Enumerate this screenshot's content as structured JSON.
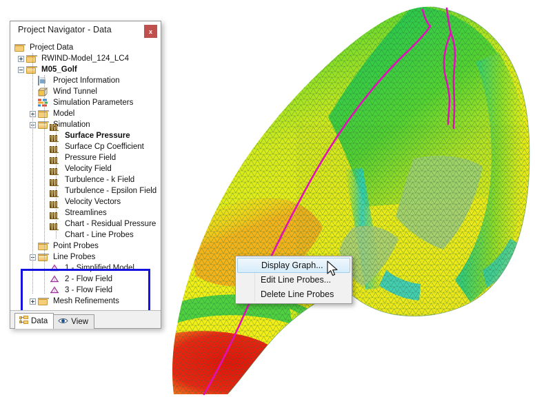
{
  "window": {
    "title": "Project Navigator - Data",
    "close_label": "x",
    "close_icon": "close-icon"
  },
  "tree": {
    "nodes": [
      {
        "id": "project-data",
        "label": "Project Data",
        "indent": 0,
        "icon": "folder-icon",
        "expander": "none",
        "bold": false
      },
      {
        "id": "rwind-model",
        "label": "RWIND-Model_124_LC4",
        "indent": 1,
        "icon": "folder-icon",
        "expander": "plus",
        "bold": false
      },
      {
        "id": "m05-golf",
        "label": "M05_Golf",
        "indent": 1,
        "icon": "folder-open-icon",
        "expander": "minus",
        "bold": true
      },
      {
        "id": "project-information",
        "label": "Project Information",
        "indent": 2,
        "icon": "document-icon",
        "expander": "none",
        "bold": false
      },
      {
        "id": "wind-tunnel",
        "label": "Wind Tunnel",
        "indent": 2,
        "icon": "cube-icon",
        "expander": "none",
        "bold": false
      },
      {
        "id": "simulation-parameters",
        "label": "Simulation Parameters",
        "indent": 2,
        "icon": "parameters-icon",
        "expander": "none",
        "bold": false
      },
      {
        "id": "model",
        "label": "Model",
        "indent": 2,
        "icon": "folder-icon",
        "expander": "plus",
        "bold": false
      },
      {
        "id": "simulation",
        "label": "Simulation",
        "indent": 2,
        "icon": "folder-open-icon",
        "expander": "minus",
        "bold": false
      },
      {
        "id": "surface-pressure",
        "label": "Surface Pressure",
        "indent": 3,
        "icon": "chart-icon",
        "expander": "none",
        "bold": true
      },
      {
        "id": "surface-cp-coefficient",
        "label": "Surface Cp Coefficient",
        "indent": 3,
        "icon": "chart-icon",
        "expander": "none",
        "bold": false
      },
      {
        "id": "pressure-field",
        "label": "Pressure Field",
        "indent": 3,
        "icon": "chart-icon",
        "expander": "none",
        "bold": false
      },
      {
        "id": "velocity-field",
        "label": "Velocity Field",
        "indent": 3,
        "icon": "chart-icon",
        "expander": "none",
        "bold": false
      },
      {
        "id": "turbulence-k-field",
        "label": "Turbulence - k Field",
        "indent": 3,
        "icon": "chart-icon",
        "expander": "none",
        "bold": false
      },
      {
        "id": "turbulence-epsilon",
        "label": "Turbulence - Epsilon Field",
        "indent": 3,
        "icon": "chart-icon",
        "expander": "none",
        "bold": false
      },
      {
        "id": "velocity-vectors",
        "label": "Velocity Vectors",
        "indent": 3,
        "icon": "chart-icon",
        "expander": "none",
        "bold": false
      },
      {
        "id": "streamlines",
        "label": "Streamlines",
        "indent": 3,
        "icon": "chart-icon",
        "expander": "none",
        "bold": false
      },
      {
        "id": "chart-residual-pressure",
        "label": "Chart - Residual Pressure",
        "indent": 3,
        "icon": "chart-icon",
        "expander": "none",
        "bold": false
      },
      {
        "id": "chart-line-probes",
        "label": "Chart - Line Probes",
        "indent": 3,
        "icon": "chart-icon",
        "expander": "none",
        "bold": false
      },
      {
        "id": "point-probes",
        "label": "Point Probes",
        "indent": 2,
        "icon": "folder-icon",
        "expander": "none",
        "bold": false
      },
      {
        "id": "line-probes",
        "label": "Line Probes",
        "indent": 2,
        "icon": "folder-open-icon",
        "expander": "minus",
        "bold": false
      },
      {
        "id": "line-probe-1",
        "label": "1 - Simplified Model",
        "indent": 3,
        "icon": "line-probe-icon",
        "expander": "none",
        "bold": false
      },
      {
        "id": "line-probe-2",
        "label": "2 - Flow Field",
        "indent": 3,
        "icon": "line-probe-icon",
        "expander": "none",
        "bold": false
      },
      {
        "id": "line-probe-3",
        "label": "3 - Flow Field",
        "indent": 3,
        "icon": "line-probe-icon",
        "expander": "none",
        "bold": false
      },
      {
        "id": "mesh-refinements",
        "label": "Mesh Refinements",
        "indent": 2,
        "icon": "folder-icon",
        "expander": "plus",
        "bold": false
      }
    ],
    "highlight_color": "#1414e0",
    "highlighted_group": "Line Probes"
  },
  "tabs": [
    {
      "id": "data",
      "label": "Data",
      "icon": "data-tree-icon",
      "active": true
    },
    {
      "id": "view",
      "label": "View",
      "icon": "eye-icon",
      "active": false
    }
  ],
  "context_menu": {
    "items": [
      {
        "id": "display-graph",
        "label": "Display Graph...",
        "highlighted": true
      },
      {
        "id": "edit-line-probes",
        "label": "Edit Line Probes...",
        "highlighted": false
      },
      {
        "id": "delete-line-probes",
        "label": "Delete Line Probes",
        "highlighted": false
      }
    ]
  },
  "viewport": {
    "name": "cfd-surface-pressure-view",
    "description": "3D car body meshed surface colored by pressure with magenta line probes",
    "colors": {
      "red": "#ee1b16",
      "orange": "#f58b1f",
      "yellow": "#f2ef18",
      "green": "#2fc52f",
      "cyan": "#1ecfd6",
      "blue": "#1832d8",
      "probe_line": "#e010b8",
      "mesh_line": "#3f7a4f",
      "background": "#ffffff"
    }
  }
}
